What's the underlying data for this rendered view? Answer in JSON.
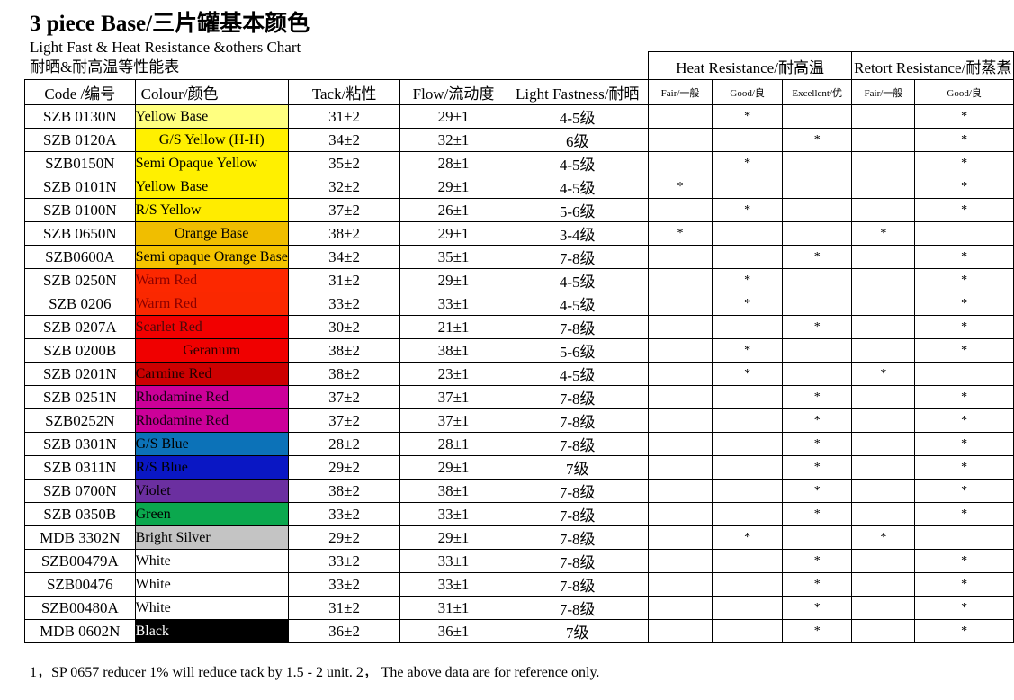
{
  "document": {
    "main_title": "3 piece Base/三片罐基本颜色",
    "subtitle_en": "Light Fast & Heat Resistance &others Chart",
    "subtitle_cn": "耐晒&耐高温等性能表",
    "footer_note": "1，SP 0657 reducer 1% will reduce tack by 1.5 - 2 unit. 2，  The above data are for reference only."
  },
  "table": {
    "group_headers": [
      {
        "label": "Heat Resistance/耐高温",
        "span": 3
      },
      {
        "label": "Retort Resistance/耐蒸煮",
        "span": 2
      }
    ],
    "columns": [
      "Code /编号",
      "Colour/颜色",
      "Tack/粘性",
      "Flow/流动度",
      "Light Fastness/耐晒"
    ],
    "sub_columns": [
      "Fair/一般",
      "Good/良",
      "Excellent/优",
      "Fair/一般",
      "Good/良"
    ],
    "star_mark": "*",
    "rows": [
      {
        "code": "SZB 0130N",
        "colour": "Yellow Base",
        "swatch": "#FFFF80",
        "text_color": "#000000",
        "align": "left",
        "tack": "31±2",
        "flow": "29±1",
        "light_fastness": "4-5级",
        "heat_fair": "",
        "heat_good": "*",
        "heat_excellent": "",
        "retort_fair": "",
        "retort_good": "*"
      },
      {
        "code": "SZB 0120A",
        "colour": "G/S Yellow (H-H)",
        "swatch": "#FFF000",
        "text_color": "#000000",
        "align": "center",
        "tack": "34±2",
        "flow": "32±1",
        "light_fastness": "6级",
        "heat_fair": "",
        "heat_good": "",
        "heat_excellent": "*",
        "retort_fair": "",
        "retort_good": "*"
      },
      {
        "code": "SZB0150N",
        "colour": "Semi Opaque Yellow",
        "swatch": "#FFF000",
        "text_color": "#000000",
        "align": "left",
        "tack": "35±2",
        "flow": "28±1",
        "light_fastness": "4-5级",
        "heat_fair": "",
        "heat_good": "*",
        "heat_excellent": "",
        "retort_fair": "",
        "retort_good": "*"
      },
      {
        "code": "SZB 0101N",
        "colour": "Yellow Base",
        "swatch": "#FFF000",
        "text_color": "#000000",
        "align": "left",
        "tack": "32±2",
        "flow": "29±1",
        "light_fastness": "4-5级",
        "heat_fair": "*",
        "heat_good": "",
        "heat_excellent": "",
        "retort_fair": "",
        "retort_good": "*"
      },
      {
        "code": "SZB 0100N",
        "colour": "R/S Yellow",
        "swatch": "#FFEC00",
        "text_color": "#000000",
        "align": "left",
        "tack": "37±2",
        "flow": "26±1",
        "light_fastness": "5-6级",
        "heat_fair": "",
        "heat_good": "*",
        "heat_excellent": "",
        "retort_fair": "",
        "retort_good": "*"
      },
      {
        "code": "SZB 0650N",
        "colour": "Orange Base",
        "swatch": "#F0BE00",
        "text_color": "#000000",
        "align": "center",
        "tack": "38±2",
        "flow": "29±1",
        "light_fastness": "3-4级",
        "heat_fair": "*",
        "heat_good": "",
        "heat_excellent": "",
        "retort_fair": "*",
        "retort_good": ""
      },
      {
        "code": "SZB0600A",
        "colour": "Semi opaque Orange Base",
        "swatch": "#F5C400",
        "text_color": "#000000",
        "align": "left",
        "tack": "34±2",
        "flow": "35±1",
        "light_fastness": "7-8级",
        "heat_fair": "",
        "heat_good": "",
        "heat_excellent": "*",
        "retort_fair": "",
        "retort_good": "*"
      },
      {
        "code": "SZB 0250N",
        "colour": "Warm Red",
        "swatch": "#FC2800",
        "text_color": "#8B0000",
        "align": "left",
        "tack": "31±2",
        "flow": "29±1",
        "light_fastness": "4-5级",
        "heat_fair": "",
        "heat_good": "*",
        "heat_excellent": "",
        "retort_fair": "",
        "retort_good": "*"
      },
      {
        "code": "SZB 0206",
        "colour": "Warm Red",
        "swatch": "#FA2800",
        "text_color": "#8B0000",
        "align": "left",
        "tack": "33±2",
        "flow": "33±1",
        "light_fastness": "4-5级",
        "heat_fair": "",
        "heat_good": "*",
        "heat_excellent": "",
        "retort_fair": "",
        "retort_good": "*"
      },
      {
        "code": "SZB 0207A",
        "colour": "Scarlet Red",
        "swatch": "#F20000",
        "text_color": "#4A0A0A",
        "align": "left",
        "tack": "30±2",
        "flow": "21±1",
        "light_fastness": "7-8级",
        "heat_fair": "",
        "heat_good": "",
        "heat_excellent": "*",
        "retort_fair": "",
        "retort_good": "*"
      },
      {
        "code": "SZB 0200B",
        "colour": "Geranium",
        "swatch": "#F00000",
        "text_color": "#2B0000",
        "align": "center",
        "tack": "38±2",
        "flow": "38±1",
        "light_fastness": "5-6级",
        "heat_fair": "",
        "heat_good": "*",
        "heat_excellent": "",
        "retort_fair": "",
        "retort_good": "*"
      },
      {
        "code": "SZB 0201N",
        "colour": "Carmine Red",
        "swatch": "#CC0000",
        "text_color": "#200000",
        "align": "left",
        "tack": "38±2",
        "flow": "23±1",
        "light_fastness": "4-5级",
        "heat_fair": "",
        "heat_good": "*",
        "heat_excellent": "",
        "retort_fair": "*",
        "retort_good": ""
      },
      {
        "code": "SZB 0251N",
        "colour": "Rhodamine Red",
        "swatch": "#CC0099",
        "text_color": "#1A0014",
        "align": "left",
        "tack": "37±2",
        "flow": "37±1",
        "light_fastness": "7-8级",
        "heat_fair": "",
        "heat_good": "",
        "heat_excellent": "*",
        "retort_fair": "",
        "retort_good": "*"
      },
      {
        "code": "SZB0252N",
        "colour": "Rhodamine Red",
        "swatch": "#CC0099",
        "text_color": "#1A0014",
        "align": "left",
        "tack": "37±2",
        "flow": "37±1",
        "light_fastness": "7-8级",
        "heat_fair": "",
        "heat_good": "",
        "heat_excellent": "*",
        "retort_fair": "",
        "retort_good": "*"
      },
      {
        "code": "SZB 0301N",
        "colour": "G/S Blue",
        "swatch": "#0C72B8",
        "text_color": "#000000",
        "align": "left",
        "tack": "28±2",
        "flow": "28±1",
        "light_fastness": "7-8级",
        "heat_fair": "",
        "heat_good": "",
        "heat_excellent": "*",
        "retort_fair": "",
        "retort_good": "*"
      },
      {
        "code": "SZB 0311N",
        "colour": "R/S Blue",
        "swatch": "#0A17C4",
        "text_color": "#000000",
        "align": "left",
        "tack": "29±2",
        "flow": "29±1",
        "light_fastness": "7级",
        "heat_fair": "",
        "heat_good": "",
        "heat_excellent": "*",
        "retort_fair": "",
        "retort_good": "*"
      },
      {
        "code": "SZB 0700N",
        "colour": "Violet",
        "swatch": "#6B2FA0",
        "text_color": "#000000",
        "align": "left",
        "tack": "38±2",
        "flow": "38±1",
        "light_fastness": "7-8级",
        "heat_fair": "",
        "heat_good": "",
        "heat_excellent": "*",
        "retort_fair": "",
        "retort_good": "*"
      },
      {
        "code": "SZB 0350B",
        "colour": "Green",
        "swatch": "#0BA84E",
        "text_color": "#000000",
        "align": "left",
        "tack": "33±2",
        "flow": "33±1",
        "light_fastness": "7-8级",
        "heat_fair": "",
        "heat_good": "",
        "heat_excellent": "*",
        "retort_fair": "",
        "retort_good": "*"
      },
      {
        "code": "MDB 3302N",
        "colour": "Bright Silver",
        "swatch": "#C4C4C4",
        "text_color": "#000000",
        "align": "left",
        "tack": "29±2",
        "flow": "29±1",
        "light_fastness": "7-8级",
        "heat_fair": "",
        "heat_good": "*",
        "heat_excellent": "",
        "retort_fair": "*",
        "retort_good": ""
      },
      {
        "code": "SZB00479A",
        "colour": "White",
        "swatch": "#FFFFFF",
        "text_color": "#000000",
        "align": "left",
        "tack": "33±2",
        "flow": "33±1",
        "light_fastness": "7-8级",
        "heat_fair": "",
        "heat_good": "",
        "heat_excellent": "*",
        "retort_fair": "",
        "retort_good": "*"
      },
      {
        "code": "SZB00476",
        "colour": "White",
        "swatch": "#FFFFFF",
        "text_color": "#000000",
        "align": "left",
        "tack": "33±2",
        "flow": "33±1",
        "light_fastness": "7-8级",
        "heat_fair": "",
        "heat_good": "",
        "heat_excellent": "*",
        "retort_fair": "",
        "retort_good": "*"
      },
      {
        "code": "SZB00480A",
        "colour": "White",
        "swatch": "#FFFFFF",
        "text_color": "#000000",
        "align": "left",
        "tack": "31±2",
        "flow": "31±1",
        "light_fastness": "7-8级",
        "heat_fair": "",
        "heat_good": "",
        "heat_excellent": "*",
        "retort_fair": "",
        "retort_good": "*"
      },
      {
        "code": "MDB 0602N",
        "colour": "Black",
        "swatch": "#000000",
        "text_color": "#FFFFFF",
        "align": "left",
        "tack": "36±2",
        "flow": "36±1",
        "light_fastness": "7级",
        "heat_fair": "",
        "heat_good": "",
        "heat_excellent": "*",
        "retort_fair": "",
        "retort_good": "*"
      }
    ]
  }
}
